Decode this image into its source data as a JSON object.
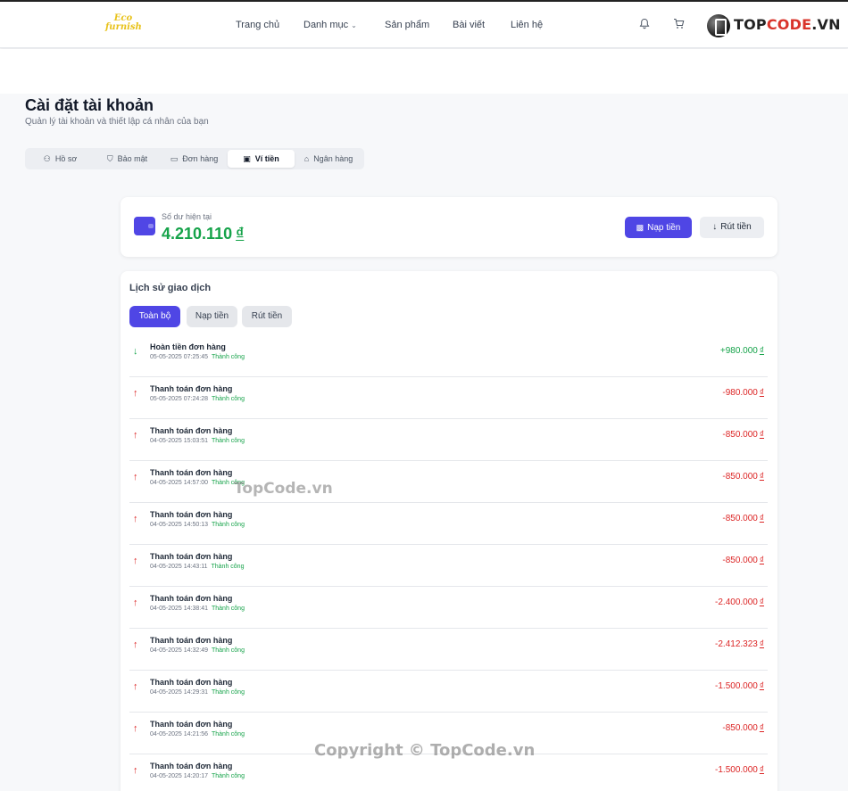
{
  "header": {
    "logo": [
      "Eco",
      "furnish"
    ],
    "nav": [
      {
        "label": "Trang chủ"
      },
      {
        "label": "Danh mục",
        "has_dropdown": true
      },
      {
        "label": "Sản phẩm"
      },
      {
        "label": "Bài viết"
      },
      {
        "label": "Liên hệ"
      }
    ],
    "icons": [
      "bell-icon",
      "cart-icon"
    ],
    "brand_logo": {
      "text_main": "TOP",
      "text_accent": "CODE",
      "text_suffix": ".VN"
    }
  },
  "page": {
    "title": "Cài đặt tài khoản",
    "subtitle": "Quản lý tài khoản và thiết lập cá nhân của bạn"
  },
  "tabs": [
    {
      "label": "Hồ sơ",
      "icon": "user-icon"
    },
    {
      "label": "Bảo mật",
      "icon": "shield-icon"
    },
    {
      "label": "Đơn hàng",
      "icon": "card-icon"
    },
    {
      "label": "Ví tiền",
      "icon": "wallet-icon",
      "active": true
    },
    {
      "label": "Ngân hàng",
      "icon": "bank-icon"
    }
  ],
  "balance": {
    "label": "Số dư hiện tại",
    "amount": "4.210.110",
    "currency": "₫",
    "deposit_label": "Nạp tiền",
    "withdraw_label": "Rút tiền"
  },
  "transactions": {
    "title": "Lịch sử giao dịch",
    "filters": [
      {
        "label": "Toàn bộ",
        "active": true
      },
      {
        "label": "Nạp tiền"
      },
      {
        "label": "Rút tiền"
      }
    ],
    "status_success": "Thành công",
    "currency": "₫",
    "items": [
      {
        "name": "Hoàn tiền đơn hàng",
        "datetime": "05-05-2025 07:25:45",
        "status": "Thành công",
        "amount": "+980.000",
        "direction": "in"
      },
      {
        "name": "Thanh toán đơn hàng",
        "datetime": "05-05-2025 07:24:28",
        "status": "Thành công",
        "amount": "-980.000",
        "direction": "out"
      },
      {
        "name": "Thanh toán đơn hàng",
        "datetime": "04-05-2025 15:03:51",
        "status": "Thành công",
        "amount": "-850.000",
        "direction": "out"
      },
      {
        "name": "Thanh toán đơn hàng",
        "datetime": "04-05-2025 14:57:00",
        "status": "Thành công",
        "amount": "-850.000",
        "direction": "out"
      },
      {
        "name": "Thanh toán đơn hàng",
        "datetime": "04-05-2025 14:50:13",
        "status": "Thành công",
        "amount": "-850.000",
        "direction": "out"
      },
      {
        "name": "Thanh toán đơn hàng",
        "datetime": "04-05-2025 14:43:11",
        "status": "Thành công",
        "amount": "-850.000",
        "direction": "out"
      },
      {
        "name": "Thanh toán đơn hàng",
        "datetime": "04-05-2025 14:38:41",
        "status": "Thành công",
        "amount": "-2.400.000",
        "direction": "out"
      },
      {
        "name": "Thanh toán đơn hàng",
        "datetime": "04-05-2025 14:32:49",
        "status": "Thành công",
        "amount": "-2.412.323",
        "direction": "out"
      },
      {
        "name": "Thanh toán đơn hàng",
        "datetime": "04-05-2025 14:29:31",
        "status": "Thành công",
        "amount": "-1.500.000",
        "direction": "out"
      },
      {
        "name": "Thanh toán đơn hàng",
        "datetime": "04-05-2025 14:21:56",
        "status": "Thành công",
        "amount": "-850.000",
        "direction": "out"
      },
      {
        "name": "Thanh toán đơn hàng",
        "datetime": "04-05-2025 14:20:17",
        "status": "Thành công",
        "amount": "-1.500.000",
        "direction": "out"
      }
    ]
  },
  "watermarks": [
    "TopCode.vn",
    "Copyright © TopCode.vn"
  ]
}
